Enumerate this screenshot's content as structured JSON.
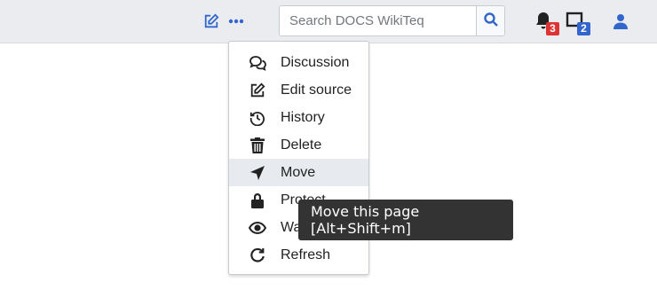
{
  "navbar": {
    "edit_icon": "edit-icon",
    "more_icon": "more-horizontal-icon",
    "search": {
      "placeholder": "Search DOCS WikiTeq",
      "value": ""
    },
    "notifications": {
      "alerts_count": "3",
      "notices_count": "2"
    }
  },
  "menu": {
    "items": [
      {
        "label": "Discussion",
        "icon": "discussion-icon"
      },
      {
        "label": "Edit source",
        "icon": "edit-source-icon"
      },
      {
        "label": "History",
        "icon": "history-icon"
      },
      {
        "label": "Delete",
        "icon": "trash-icon"
      },
      {
        "label": "Move",
        "icon": "move-arrow-icon"
      },
      {
        "label": "Protect",
        "icon": "lock-icon"
      },
      {
        "label": "Watch",
        "icon": "eye-icon"
      },
      {
        "label": "Refresh",
        "icon": "refresh-icon"
      }
    ],
    "hovered": "Move"
  },
  "tooltip": {
    "text": "Move this page [Alt+Shift+m]"
  },
  "colors": {
    "navbar_bg": "#eaecf0",
    "accent": "#3366cc",
    "alert_badge": "#dd3333",
    "notice_badge": "#3366cc",
    "tooltip_bg": "#333333"
  }
}
